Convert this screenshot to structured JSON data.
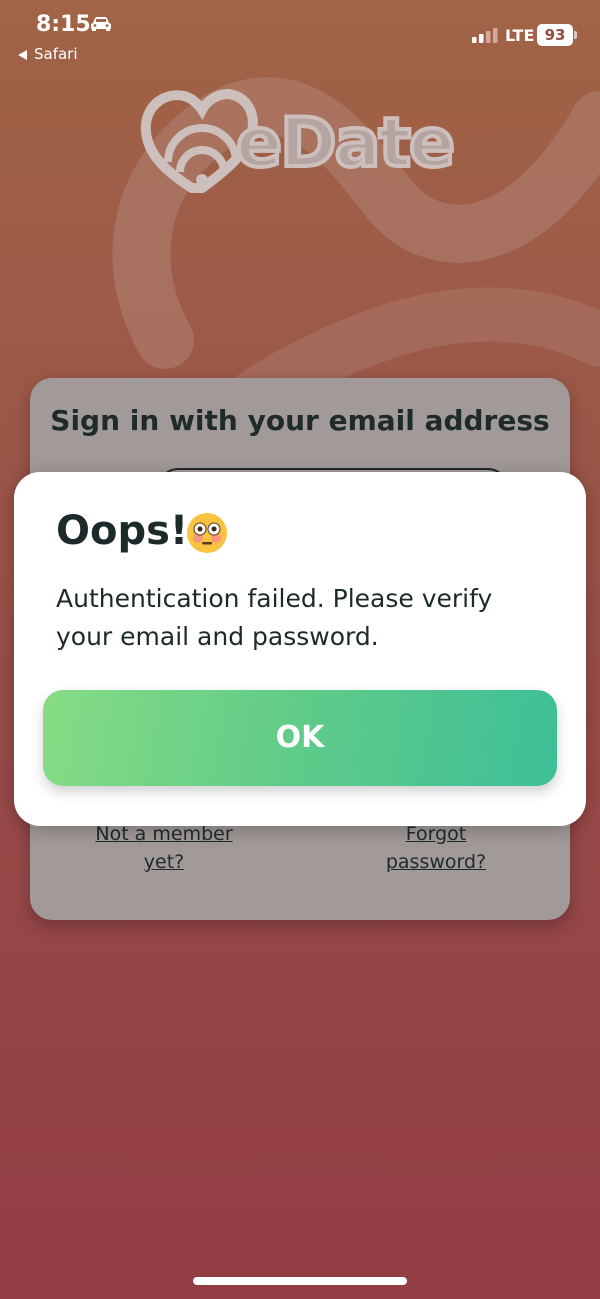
{
  "status_bar": {
    "time": "8:15",
    "back_app": "Safari",
    "network": "LTE",
    "battery": "93",
    "icons": [
      "car-icon",
      "back-arrow-icon",
      "signal-icon",
      "battery-icon"
    ]
  },
  "logo": {
    "text": "eDate",
    "icon": "heart-wifi-logo-icon"
  },
  "signin": {
    "title": "Sign in with your email address",
    "not_member_link": "Not a member\nyet?",
    "forgot_link": "Forgot\npassword?"
  },
  "dialog": {
    "title": "Oops!",
    "emoji": "flushed-emoji-icon",
    "message": "Authentication failed. Please verify your email and password.",
    "ok_label": "OK"
  },
  "colors": {
    "ok_gradient_start": "#86dc84",
    "ok_gradient_end": "#3dbf98",
    "dialog_text": "#1c2a29",
    "background_top": "#a06446",
    "background_bottom": "#923c44"
  }
}
